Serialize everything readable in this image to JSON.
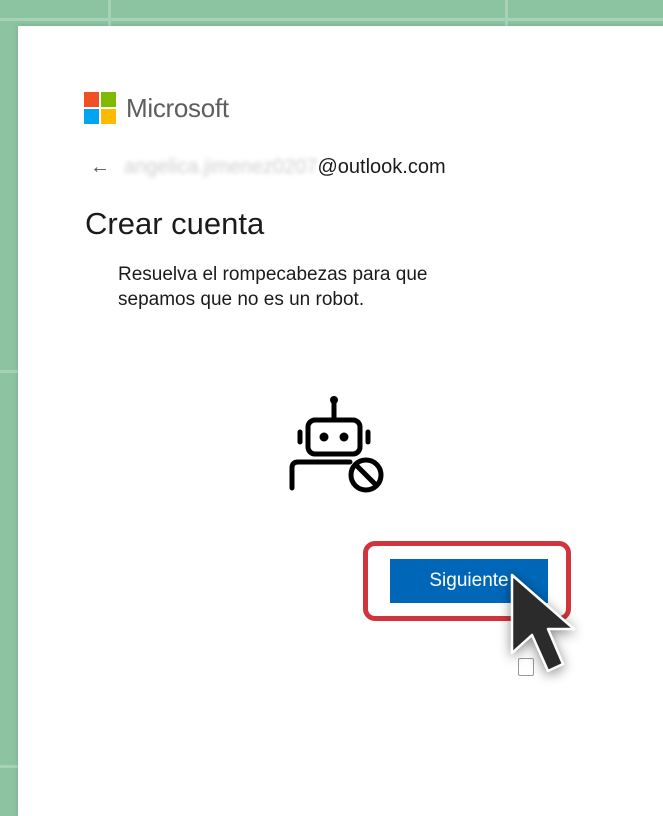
{
  "brand": {
    "name": "Microsoft",
    "colors": [
      "#f25022",
      "#7fba00",
      "#00a4ef",
      "#ffb900"
    ]
  },
  "account": {
    "back_icon": "back-arrow-icon",
    "email_hidden": "angelica.jimenez0207",
    "email_domain": "@outlook.com"
  },
  "page": {
    "title": "Crear cuenta",
    "description": "Resuelva el rompecabezas para que sepamos que no es un robot."
  },
  "illustration": {
    "icon": "robot-blocked-icon"
  },
  "actions": {
    "next_label": "Siguiente"
  },
  "colors": {
    "background": "#8cc3a0",
    "button": "#0067b8",
    "highlight": "#d0343c"
  }
}
